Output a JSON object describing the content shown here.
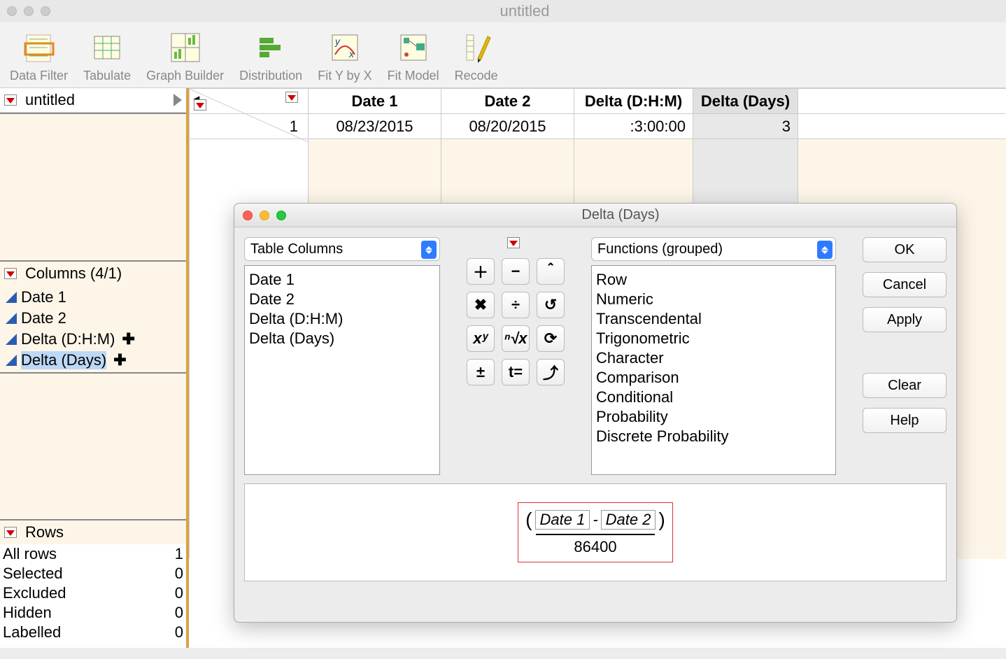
{
  "window": {
    "title": "untitled"
  },
  "toolbar": {
    "items": [
      {
        "label": "Data Filter"
      },
      {
        "label": "Tabulate"
      },
      {
        "label": "Graph Builder"
      },
      {
        "label": "Distribution"
      },
      {
        "label": "Fit Y by X"
      },
      {
        "label": "Fit Model"
      },
      {
        "label": "Recode"
      }
    ]
  },
  "panels": {
    "table_name": "untitled",
    "columns_header": "Columns (4/1)",
    "columns": [
      {
        "label": "Date 1",
        "formula": false,
        "selected": false
      },
      {
        "label": "Date 2",
        "formula": false,
        "selected": false
      },
      {
        "label": "Delta (D:H:M)",
        "formula": true,
        "selected": false
      },
      {
        "label": "Delta (Days)",
        "formula": true,
        "selected": true
      }
    ],
    "rows_header": "Rows",
    "rows": [
      {
        "label": "All rows",
        "value": "1"
      },
      {
        "label": "Selected",
        "value": "0"
      },
      {
        "label": "Excluded",
        "value": "0"
      },
      {
        "label": "Hidden",
        "value": "0"
      },
      {
        "label": "Labelled",
        "value": "0"
      }
    ]
  },
  "grid": {
    "headers": [
      "Date 1",
      "Date 2",
      "Delta (D:H:M)",
      "Delta (Days)"
    ],
    "selected_col_index": 3,
    "rows": [
      {
        "num": "1",
        "cells": [
          "08/23/2015",
          "08/20/2015",
          ":3:00:00",
          "3"
        ]
      }
    ]
  },
  "dialog": {
    "title": "Delta (Days)",
    "column_selector": "Table Columns",
    "columns_list": [
      "Date 1",
      "Date 2",
      "Delta (D:H:M)",
      "Delta (Days)"
    ],
    "function_selector": "Functions (grouped)",
    "functions_list": [
      "Row",
      "Numeric",
      "Transcendental",
      "Trigonometric",
      "Character",
      "Comparison",
      "Conditional",
      "Probability",
      "Discrete Probability"
    ],
    "ops": {
      "r1": [
        "＋",
        "−",
        "＾"
      ],
      "r2": [
        "✖",
        "÷",
        "↺"
      ],
      "r3": [
        "xʸ",
        "ⁿ√x",
        "⟳"
      ],
      "r4": [
        "±",
        "t=",
        "⤴"
      ]
    },
    "buttons": {
      "ok": "OK",
      "cancel": "Cancel",
      "apply": "Apply",
      "clear": "Clear",
      "help": "Help"
    },
    "formula": {
      "a": "Date 1",
      "op": "-",
      "b": "Date 2",
      "denom": "86400"
    }
  }
}
